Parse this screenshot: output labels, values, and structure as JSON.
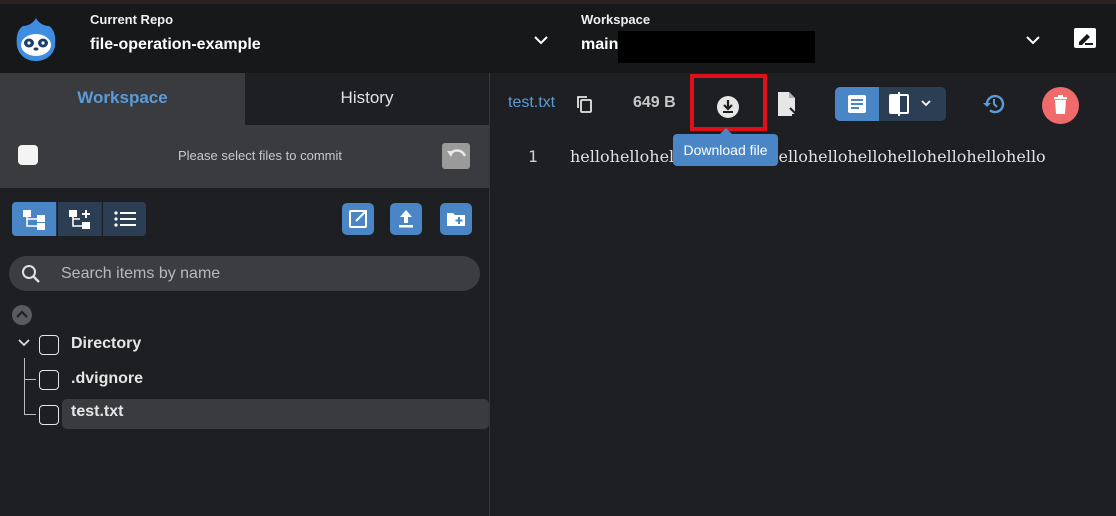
{
  "header": {
    "repo_label": "Current Repo",
    "repo_name": "file-operation-example",
    "workspace_label": "Workspace",
    "workspace_name": "main",
    "repo_dropdown_icon": "chevron-down-icon",
    "workspace_dropdown_icon": "chevron-down-icon",
    "edit_icon": "edit-note-icon"
  },
  "left_panel": {
    "tabs": [
      {
        "label": "Workspace",
        "active": true
      },
      {
        "label": "History",
        "active": false
      }
    ],
    "commit_bar": {
      "message": "Please select files to commit",
      "undo_icon": "undo-icon"
    },
    "view_modes": [
      {
        "icon": "tree-view-icon",
        "active": true
      },
      {
        "icon": "tree-add-icon",
        "active": false
      },
      {
        "icon": "list-view-icon",
        "active": false
      }
    ],
    "actions": [
      {
        "icon": "open-external-icon"
      },
      {
        "icon": "upload-icon"
      },
      {
        "icon": "new-folder-icon"
      }
    ],
    "search": {
      "placeholder": "Search items by name"
    },
    "tree": [
      {
        "label": "Directory",
        "type": "folder",
        "expanded": true
      },
      {
        "label": ".dvignore",
        "type": "file"
      },
      {
        "label": "test.txt",
        "type": "file",
        "selected": true
      }
    ]
  },
  "right_panel": {
    "file_name": "test.txt",
    "file_size": "649 B",
    "tooltip": "Download file",
    "toolbar_icons": [
      "copy-icon",
      "download-icon",
      "file-icon",
      "text-view-icon",
      "diff-view-icon",
      "history-icon",
      "delete-icon"
    ],
    "editor": {
      "line_number": "1",
      "line_text": "hellohellohellohellohellohellohellohellohellohellohellohello"
    }
  },
  "colors": {
    "accent": "#4a86c5",
    "link": "#5b9bd9",
    "delete": "#ef6b6b",
    "highlight_box": "#e0101a"
  }
}
